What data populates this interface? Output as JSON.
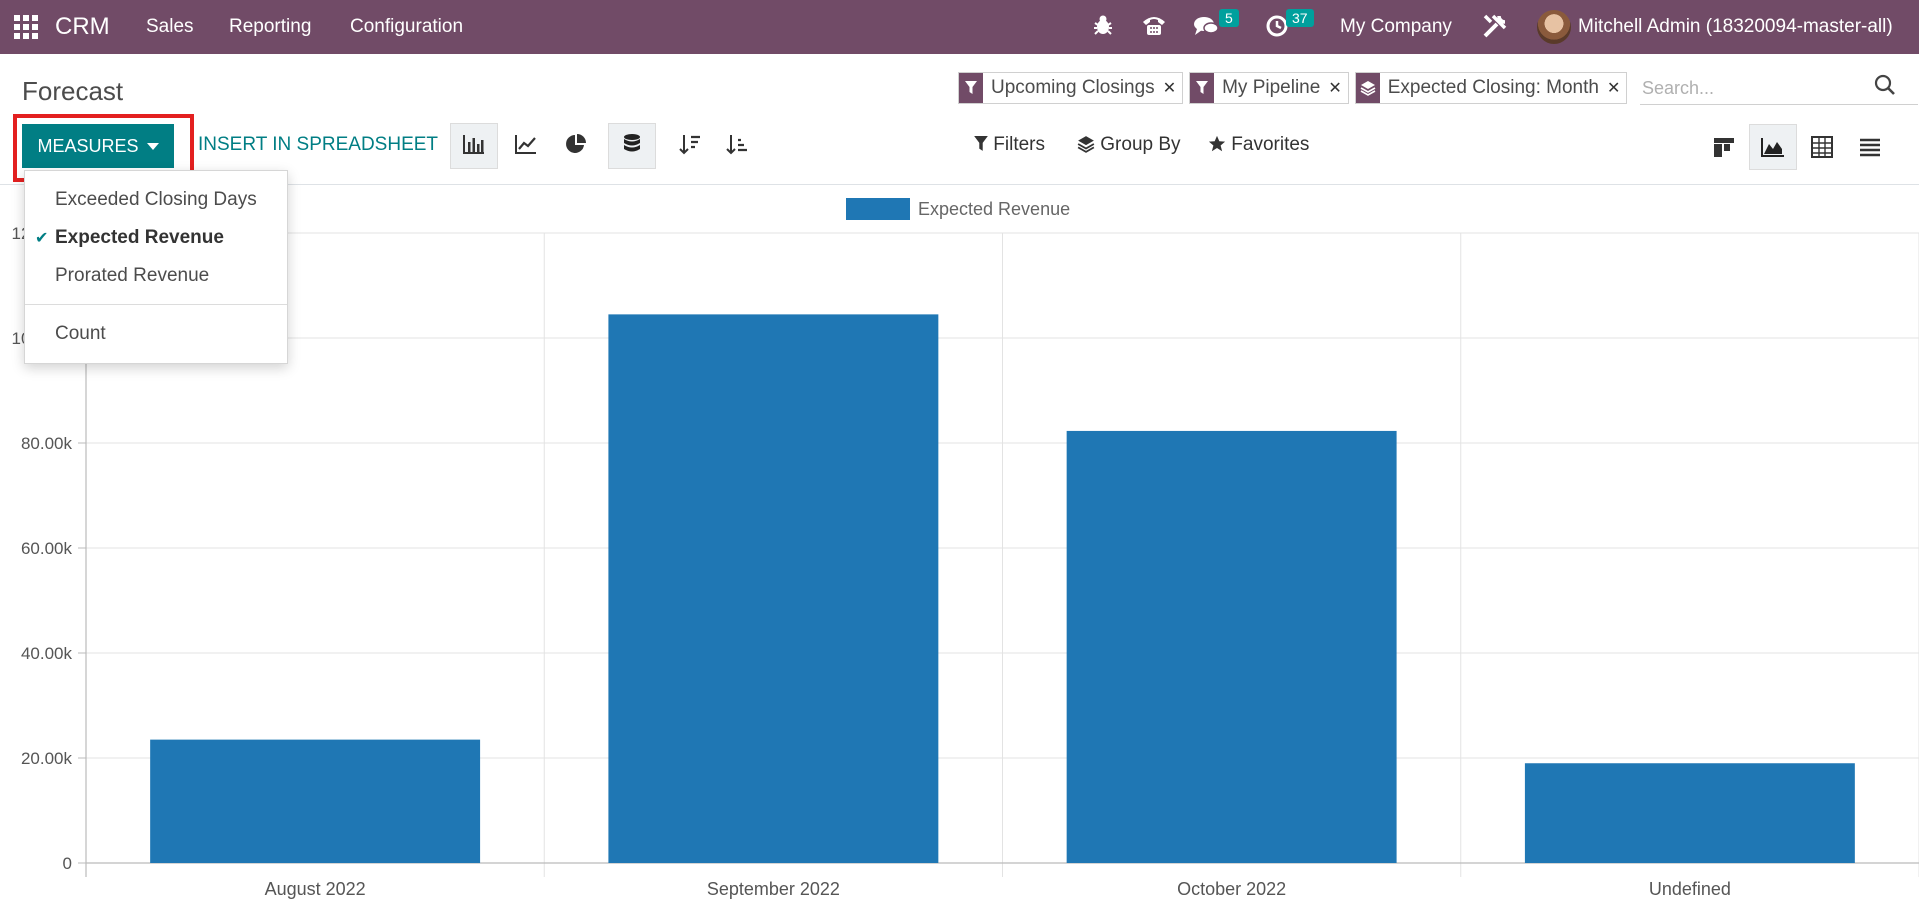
{
  "navbar": {
    "app_name": "CRM",
    "menus": [
      "Sales",
      "Reporting",
      "Configuration"
    ],
    "messages_count": "5",
    "activities_count": "37",
    "company": "My Company",
    "user": "Mitchell Admin (18320094-master-all)",
    "brand_color": "#714b67"
  },
  "control_panel": {
    "title": "Forecast",
    "facets": [
      {
        "icon": "filter-icon",
        "label": "Upcoming Closings"
      },
      {
        "icon": "filter-icon",
        "label": "My Pipeline"
      },
      {
        "icon": "layers-icon",
        "label": "Expected Closing: Month"
      }
    ],
    "search_placeholder": "Search...",
    "measures_label": "MEASURES",
    "insert_label": "INSERT IN SPREADSHEET",
    "filters_label": "Filters",
    "groupby_label": "Group By",
    "favorites_label": "Favorites",
    "accent_color": "#017e84"
  },
  "measures_menu": {
    "items": [
      {
        "label": "Exceeded Closing Days",
        "checked": false
      },
      {
        "label": "Expected Revenue",
        "checked": true
      },
      {
        "label": "Prorated Revenue",
        "checked": false
      },
      {
        "label": "Count",
        "checked": false
      }
    ]
  },
  "chart_data": {
    "type": "bar",
    "categories": [
      "August 2022",
      "September 2022",
      "October 2022",
      "Undefined"
    ],
    "series": [
      {
        "name": "Expected Revenue",
        "values": [
          23500,
          104500,
          82300,
          19000
        ],
        "color": "#1f77b4"
      }
    ],
    "yticks": [
      "0",
      "20.00k",
      "40.00k",
      "60.00k",
      "80.00k",
      "100.00k",
      "120.00k"
    ],
    "ylim": [
      0,
      120000
    ],
    "legend": "top",
    "grid": true
  }
}
